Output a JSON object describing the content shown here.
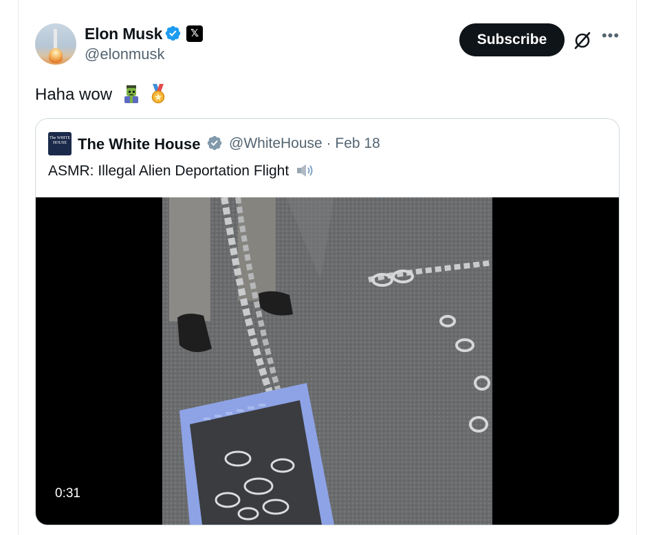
{
  "author": {
    "name": "Elon Musk",
    "handle": "@elonmusk",
    "badge_icon": "verified-badge-icon",
    "affiliate_icon": "x-logo-icon",
    "badge_color": "#1d9bf0"
  },
  "actions": {
    "subscribe_label": "Subscribe",
    "grok_icon": "grok-icon",
    "more_icon": "more-icon"
  },
  "tweet": {
    "text": "Haha wow",
    "emojis": [
      "zombie-emoji",
      "medal-emoji"
    ]
  },
  "quoted": {
    "name": "The White House",
    "handle": "@WhiteHouse",
    "separator": "·",
    "date": "Feb 18",
    "text": "ASMR: Illegal Alien Deportation Flight",
    "badge_color": "#829aab",
    "avatar_text": "The WHITE HOUSE"
  },
  "video": {
    "duration": "0:31"
  }
}
